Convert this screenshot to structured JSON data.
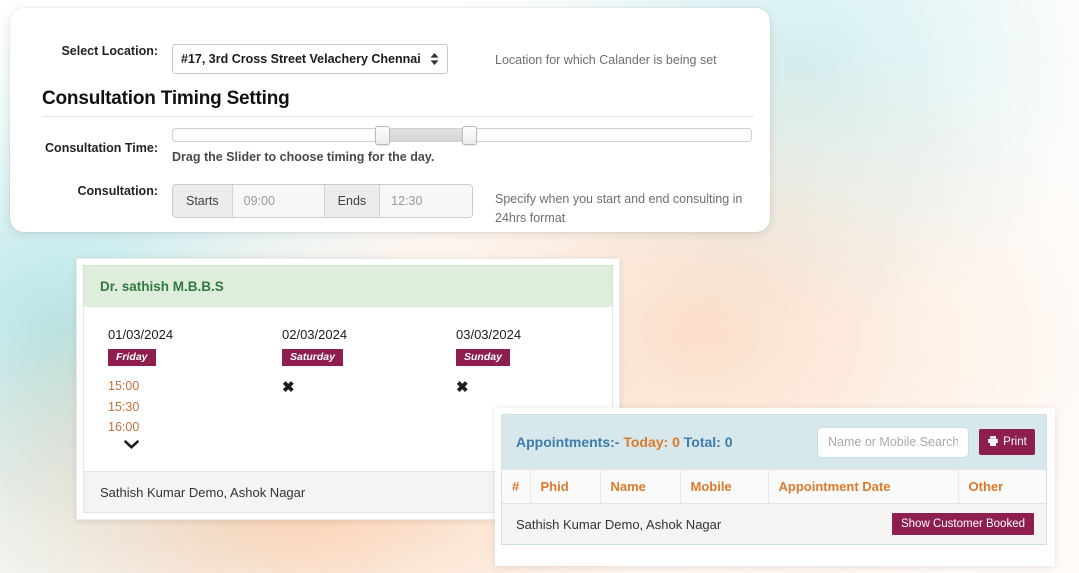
{
  "settings": {
    "location_label": "Select Location:",
    "location_value": "#17, 3rd Cross Street Velachery Chennai",
    "location_help": "Location for which Calander is being set",
    "location_options": [
      "#17, 3rd Cross Street Velachery Chennai"
    ],
    "section_title": "Consultation Timing Setting",
    "time_label": "Consultation Time:",
    "slider_hint": "Drag the Slider to choose timing for the day.",
    "slider": {
      "start_percent": 36,
      "end_percent": 51
    },
    "consultation_label": "Consultation:",
    "starts_addon": "Starts",
    "starts_value": "09:00",
    "ends_addon": "Ends",
    "ends_value": "12:30",
    "consultation_help": "Specify when you start and end consulting in 24hrs format"
  },
  "schedule": {
    "doctor": "Dr. sathish M.B.B.S",
    "days": [
      {
        "date": "01/03/2024",
        "day": "Friday",
        "slots": [
          "15:00",
          "15:30",
          "16:00"
        ],
        "closed": false,
        "more_icon": "chevron-down-icon"
      },
      {
        "date": "02/03/2024",
        "day": "Saturday",
        "slots": [],
        "closed": true,
        "closed_icon": "✖"
      },
      {
        "date": "03/03/2024",
        "day": "Sunday",
        "slots": [],
        "closed": true,
        "closed_icon": "✖"
      }
    ],
    "footer_text": "Sathish Kumar Demo, Ashok Nagar"
  },
  "appointments": {
    "title_main": "Appointments:-",
    "today_label": "Today:",
    "today_count": "0",
    "total_label": "Total:",
    "total_count": "0",
    "search_placeholder": "Name or Mobile Search",
    "search_value": "",
    "print_label": "Print",
    "print_icon": "printer-icon",
    "columns": [
      "#",
      "Phid",
      "Name",
      "Mobile",
      "Appointment Date",
      "Other"
    ],
    "rows": [],
    "footer_name": "Sathish Kumar Demo, Ashok Nagar",
    "show_booked_label": "Show Customer Booked"
  },
  "colors": {
    "maroon": "#8e1e4e",
    "orange": "#dd7a2a",
    "blue": "#3d7ca8",
    "green": "#2f7a3f",
    "slot_orange": "#c4703a"
  }
}
